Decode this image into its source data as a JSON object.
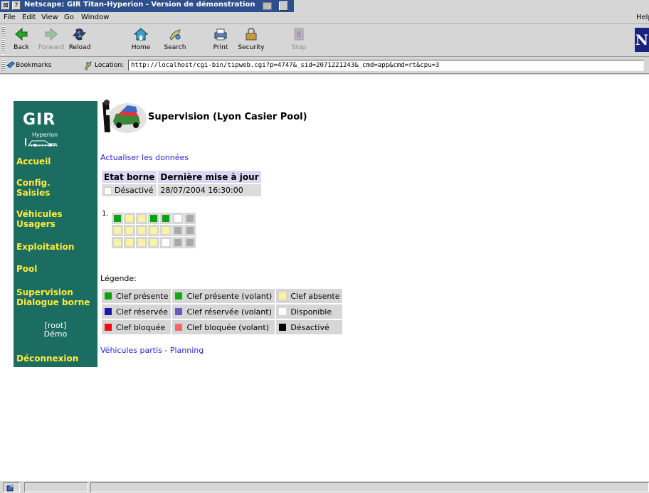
{
  "window": {
    "title": "Netscape: GIR Titan-Hyperion - Version de démonstration"
  },
  "menu": [
    "File",
    "Edit",
    "View",
    "Go",
    "Window"
  ],
  "menu_help": "Help",
  "toolbar": {
    "buttons": [
      {
        "label": "Back",
        "icon": "back-arrow-icon",
        "enabled": true
      },
      {
        "label": "Forward",
        "icon": "forward-arrow-icon",
        "enabled": false
      },
      {
        "label": "Reload",
        "icon": "reload-icon",
        "enabled": true
      },
      {
        "label": "Home",
        "icon": "home-icon",
        "enabled": true
      },
      {
        "label": "Search",
        "icon": "search-icon",
        "enabled": true
      },
      {
        "label": "Print",
        "icon": "printer-icon",
        "enabled": true
      },
      {
        "label": "Security",
        "icon": "padlock-icon",
        "enabled": true
      },
      {
        "label": "Stop",
        "icon": "stop-icon",
        "enabled": false
      }
    ],
    "logo_letter": "N"
  },
  "location": {
    "bookmarks_label": "Bookmarks",
    "location_label": "Location:",
    "url": "http://localhost/cgi-bin/tipweb.cgi?p=4747&_sid=2071221243&_cmd=app&cmd=rt&cpu=3"
  },
  "nav": {
    "logo_text": "GIR",
    "logo_subtext": "Hyperion",
    "items": [
      "Accueil",
      "Config.\nSaisies",
      "Véhicules\nUsagers",
      "Exploitation",
      "Pool",
      "Supervision\nDialogue borne"
    ],
    "user_role": "[root]",
    "user_name": "Démo",
    "logout": "Déconnexion"
  },
  "page": {
    "title": "Supervision (Lyon Casier Pool)",
    "refresh_link": "Actualiser les données",
    "status_table": {
      "headers": [
        "Etat borne",
        "Dernière mise à jour"
      ],
      "state": "Désactivé",
      "last_update": "28/07/2004 16:30:00"
    },
    "cabinet": {
      "number": "1.",
      "rows": [
        [
          "present",
          "absent",
          "absent",
          "present",
          "present",
          "available",
          "disabled"
        ],
        [
          "absent",
          "absent",
          "absent",
          "absent",
          "absent",
          "disabled",
          "disabled"
        ],
        [
          "absent",
          "absent",
          "absent",
          "absent",
          "available",
          "disabled",
          "disabled"
        ]
      ]
    },
    "legend_title": "Légende:",
    "legend": [
      [
        {
          "label": "Clef présente",
          "color": "#0ea10e"
        },
        {
          "label": "Clef présente (volant)",
          "color": "#16a516"
        },
        {
          "label": "Clef absente",
          "color": "#fbf3a3"
        }
      ],
      [
        {
          "label": "Clef réservée",
          "color": "#1a1aa6"
        },
        {
          "label": "Clef réservée (volant)",
          "color": "#6a5ab8"
        },
        {
          "label": "Disponible",
          "color": "#ffffff"
        }
      ],
      [
        {
          "label": "Clef bloquée",
          "color": "#ee1010"
        },
        {
          "label": "Clef bloquée (volant)",
          "color": "#f26a6a"
        },
        {
          "label": "Désactivé",
          "color": "#000000"
        }
      ]
    ],
    "footer_link": "Véhicules partis - Planning"
  },
  "slot_colors": {
    "present": "#0ea10e",
    "absent": "#fbf3a3",
    "available": "#ffffff",
    "disabled": "#a9a9a9"
  }
}
